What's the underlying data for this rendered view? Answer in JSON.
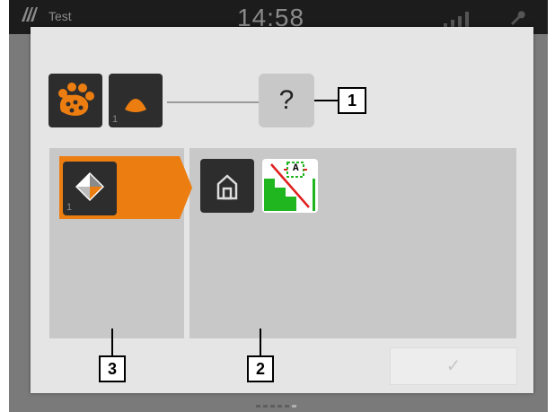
{
  "status_bar": {
    "machine_name": "Test",
    "clock": "14:58",
    "signal_icon": "signal-bars-icon",
    "service_icon": "wrench-icon"
  },
  "dialog": {
    "chain": {
      "tractor_icon": "tractor-paw-icon",
      "implement_icon": "spreader-cone-icon",
      "implement_index": "1",
      "unknown_label": "?"
    },
    "left_list": {
      "items": [
        {
          "icon": "section-control-icon",
          "index": "1",
          "selected": true
        }
      ]
    },
    "right_list": {
      "items": [
        {
          "icon": "home-icon"
        },
        {
          "icon": "automatic-section-control-icon",
          "badge": "A"
        }
      ]
    },
    "confirm_label": "✓"
  },
  "callouts": {
    "one": "1",
    "two": "2",
    "three": "3"
  },
  "colors": {
    "accent": "#ec7d10",
    "tile_dark": "#2d2d2d",
    "panel": "#c8c8c8",
    "dialog_bg": "#e5e5e5",
    "green": "#1fb61f"
  }
}
